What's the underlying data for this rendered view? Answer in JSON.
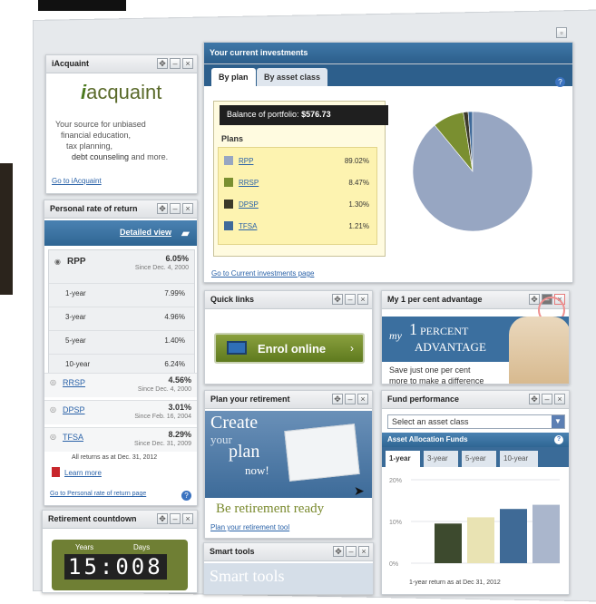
{
  "top_controls": {
    "maximize_glyph": "▫"
  },
  "acquaint": {
    "title": "iAcquaint",
    "logo_i": "i",
    "logo_text": "acquaint",
    "line1": "Your source for unbiased",
    "line2": "financial education,",
    "line3": "tax planning,",
    "line4_strong": "debt counseling",
    "line4_rest": " and more.",
    "link": "Go to iAcquaint"
  },
  "investments": {
    "title": "Your current investments",
    "tabs": [
      "By plan",
      "By asset class"
    ],
    "balance_label": "Balance of portfolio:",
    "balance_value": "$576.73",
    "plans_header": "Plans",
    "plans": [
      {
        "name": "RPP",
        "pct": "89.02%",
        "color": "#97a6c2"
      },
      {
        "name": "RRSP",
        "pct": "8.47%",
        "color": "#7a8f30"
      },
      {
        "name": "DPSP",
        "pct": "1.30%",
        "color": "#3c3a2a"
      },
      {
        "name": "TFSA",
        "pct": "1.21%",
        "color": "#3f6a9a"
      }
    ],
    "link": "Go to Current investments page"
  },
  "chart_data": {
    "type": "pie",
    "categories": [
      "RPP",
      "RRSP",
      "DPSP",
      "TFSA"
    ],
    "values": [
      89.02,
      8.47,
      1.3,
      1.21
    ],
    "colors": [
      "#97a6c2",
      "#7a8f30",
      "#3c3a2a",
      "#3f6a9a"
    ]
  },
  "ror": {
    "title": "Personal rate of return",
    "detailed_view": "Detailed view",
    "main": {
      "name": "RPP",
      "value": "6.05%",
      "since": "Since Dec. 4, 2000"
    },
    "periods": [
      {
        "label": "1-year",
        "value": "7.99%"
      },
      {
        "label": "3-year",
        "value": "4.96%"
      },
      {
        "label": "5-year",
        "value": "1.40%"
      },
      {
        "label": "10-year",
        "value": "6.24%"
      }
    ],
    "others": [
      {
        "name": "RRSP",
        "value": "4.56%",
        "since": "Since Dec. 4, 2000"
      },
      {
        "name": "DPSP",
        "value": "3.01%",
        "since": "Since Feb. 16, 2004"
      },
      {
        "name": "TFSA",
        "value": "8.29%",
        "since": "Since Dec. 31, 2009"
      }
    ],
    "note": "All returns as at Dec. 31, 2012",
    "learn_more": "Learn more",
    "link": "Go to Personal rate of return page"
  },
  "countdown": {
    "title": "Retirement countdown",
    "years_label": "Years",
    "days_label": "Days",
    "digits": "15:008"
  },
  "quick_links": {
    "title": "Quick links",
    "enrol": "Enrol online"
  },
  "advantage": {
    "title": "My 1 per cent advantage",
    "banner_my": "my",
    "banner_1": "1",
    "banner_percent": "PERCENT",
    "banner_advantage": "ADVANTAGE",
    "text1": "Save just one per cent",
    "text2": "more to make a difference"
  },
  "retirement": {
    "title": "Plan your retirement",
    "create": "Create",
    "your": "your",
    "plan": "plan",
    "now": "now!",
    "tagline": "Be retirement ready",
    "link": "Plan your retirement tool"
  },
  "smart_tools": {
    "title": "Smart tools",
    "banner": "Smart tools"
  },
  "fund": {
    "title": "Fund performance",
    "select_value": "Select an asset class",
    "section": "Asset Allocation Funds",
    "tabs": [
      "1-year",
      "3-year",
      "5-year",
      "10-year"
    ],
    "y_ticks": [
      "20%",
      "10%",
      "0%"
    ],
    "footer": "1-year return as at Dec 31, 2012"
  },
  "fund_chart": {
    "type": "bar",
    "values": [
      9.5,
      11,
      13,
      14
    ],
    "colors": [
      "#3d4a2e",
      "#e9e3b3",
      "#3f6a96",
      "#aab6cc"
    ],
    "ylim": [
      0,
      20
    ]
  }
}
